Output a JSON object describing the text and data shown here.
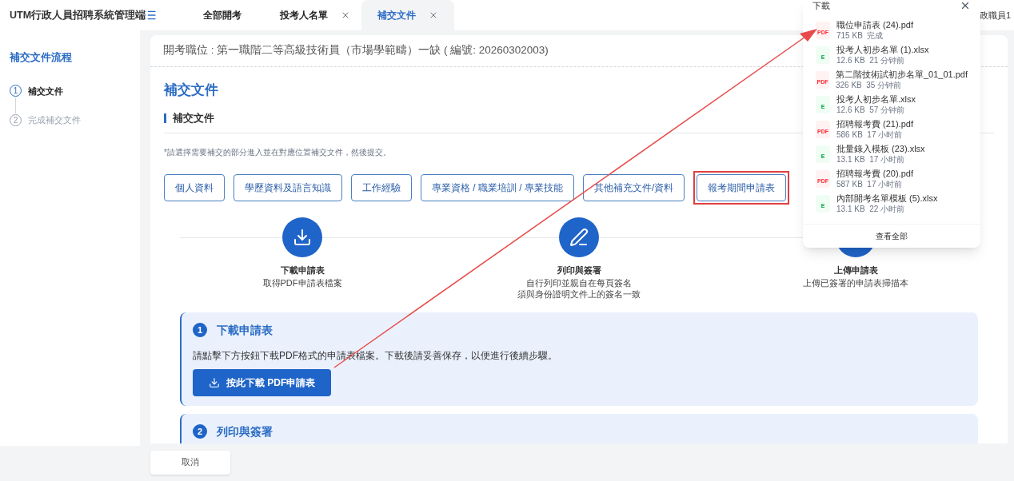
{
  "header": {
    "app_name": "UTM行政人員招聘系統管理端",
    "tabs": [
      {
        "label": "全部開考",
        "closable": false,
        "selected": false
      },
      {
        "label": "投考人名單",
        "closable": true,
        "selected": false
      },
      {
        "label": "補交文件",
        "closable": true,
        "selected": true
      }
    ],
    "user": "政職員1"
  },
  "sidebar": {
    "title": "補交文件流程",
    "steps": [
      {
        "number": "1",
        "label": "補交文件",
        "selected": true
      },
      {
        "number": "2",
        "label": "完成補交文件",
        "selected": false
      }
    ]
  },
  "position_line": "開考職位 : 第一職階二等高級技術員（市場學範疇）一缺 ( 編號: 20260302003)",
  "page_title": "補交文件",
  "section_title": "補交文件",
  "hint": "*請選擇需要補交的部分進入並在對應位置補交文件，然後提交。",
  "categories": [
    {
      "label": "個人資料",
      "highlighted": false
    },
    {
      "label": "學歷資料及語言知識",
      "highlighted": false
    },
    {
      "label": "工作經驗",
      "highlighted": false
    },
    {
      "label": "專業資格 / 職業培訓 / 專業技能",
      "highlighted": false
    },
    {
      "label": "其他補充文件/資料",
      "highlighted": false
    },
    {
      "label": "報考期間申請表",
      "highlighted": true
    }
  ],
  "process_steps": [
    {
      "kind": "download",
      "title": "下載申請表",
      "lines": [
        "取得PDF申請表檔案"
      ]
    },
    {
      "kind": "sign",
      "title": "列印與簽署",
      "lines": [
        "自行列印並親自在每頁簽名",
        "須與身份證明文件上的簽名一致"
      ]
    },
    {
      "kind": "upload",
      "title": "上傳申請表",
      "lines": [
        "上傳已簽署的申請表掃描本"
      ]
    }
  ],
  "cards": [
    {
      "number": "1",
      "title": "下載申請表",
      "text": "請點擊下方按鈕下載PDF格式的申請表檔案。下載後請妥善保存，以便進行後續步驟。",
      "button": "按此下載 PDF申請表"
    },
    {
      "number": "2",
      "title": "列印與簽署"
    }
  ],
  "cancel": "取消",
  "downloads": {
    "title": "下載",
    "items": [
      {
        "kind": "pdf",
        "badge": "PDF",
        "name": "職位申請表 (24).pdf",
        "meta": "715 KB  完成"
      },
      {
        "kind": "xlsx",
        "badge": "E",
        "name": "投考人初步名單 (1).xlsx",
        "meta": "12.6 KB  21 分钟前"
      },
      {
        "kind": "pdf",
        "badge": "PDF",
        "name": "第二階技術試初步名單_01_01.pdf",
        "meta": "326 KB  35 分钟前"
      },
      {
        "kind": "xlsx",
        "badge": "E",
        "name": "投考人初步名單.xlsx",
        "meta": "12.6 KB  57 分钟前"
      },
      {
        "kind": "pdf",
        "badge": "PDF",
        "name": "招聘報考費 (21).pdf",
        "meta": "586 KB  17 小时前"
      },
      {
        "kind": "xlsx",
        "badge": "E",
        "name": "批量錄入模板 (23).xlsx",
        "meta": "13.1 KB  17 小时前"
      },
      {
        "kind": "pdf",
        "badge": "PDF",
        "name": "招聘報考費 (20).pdf",
        "meta": "587 KB  17 小时前"
      },
      {
        "kind": "xlsx",
        "badge": "E",
        "name": "內部開考名單模板 (5).xlsx",
        "meta": "13.1 KB  22 小时前"
      }
    ],
    "footer": "查看全部"
  }
}
